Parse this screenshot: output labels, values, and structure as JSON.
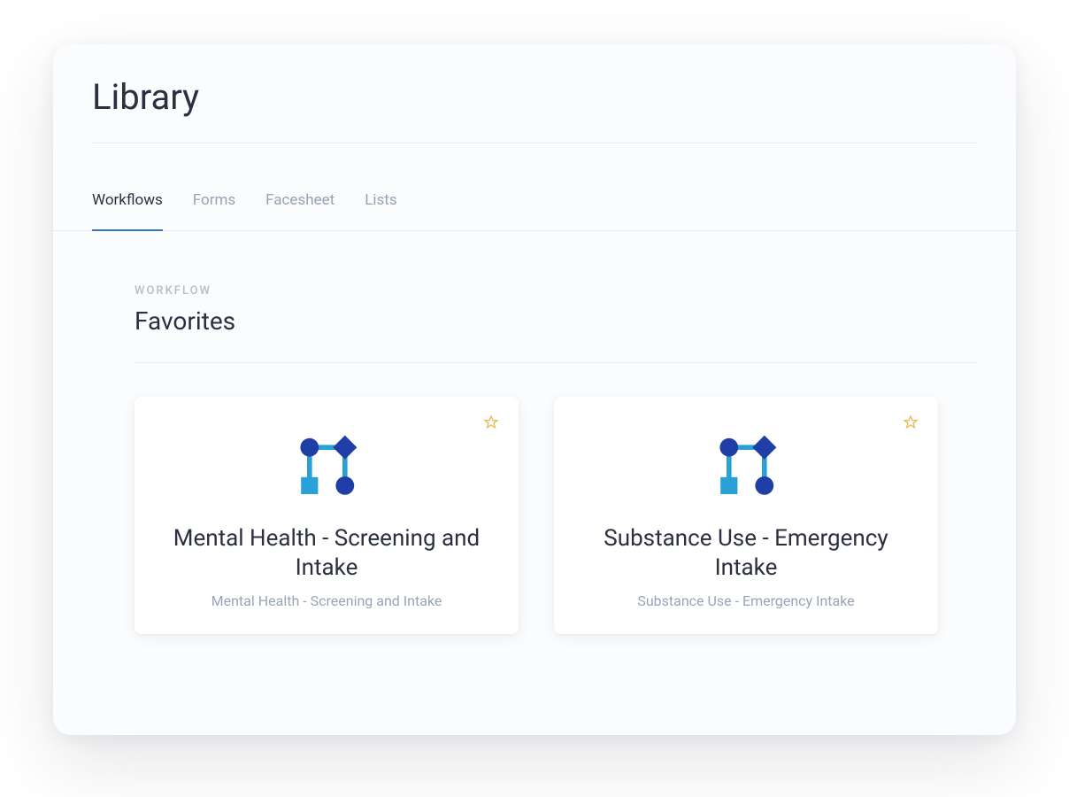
{
  "page": {
    "title": "Library"
  },
  "tabs": [
    {
      "label": "Workflows",
      "active": true
    },
    {
      "label": "Forms",
      "active": false
    },
    {
      "label": "Facesheet",
      "active": false
    },
    {
      "label": "Lists",
      "active": false
    }
  ],
  "section": {
    "eyebrow": "WORKFLOW",
    "title": "Favorites"
  },
  "cards": [
    {
      "title": "Mental Health - Screening and Intake",
      "subtitle": "Mental Health - Screening and Intake",
      "icon": "workflow-icon",
      "starred": true
    },
    {
      "title": "Substance Use - Emergency Intake",
      "subtitle": "Substance Use - Emergency Intake",
      "icon": "workflow-icon",
      "starred": true
    }
  ],
  "colors": {
    "accent": "#2f74c0",
    "iconDark": "#1f3fa6",
    "iconLight": "#2aa0d8",
    "starOutline": "#e6b648"
  }
}
